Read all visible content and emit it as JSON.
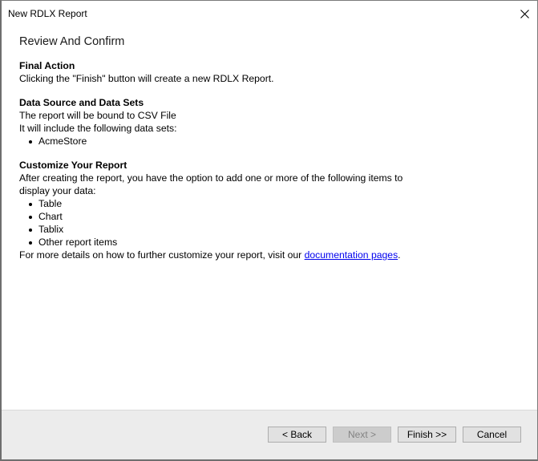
{
  "window": {
    "title": "New RDLX Report",
    "close_icon": "close-icon"
  },
  "main": {
    "heading": "Review And Confirm",
    "sections": [
      {
        "title": "Final Action",
        "lines": [
          "Clicking the \"Finish\" button will create a new RDLX Report."
        ]
      },
      {
        "title": "Data Source and Data Sets",
        "lines": [
          "The report will be bound to CSV File",
          "It will include the following data sets:"
        ],
        "bullets": [
          "AcmeStore"
        ]
      },
      {
        "title": "Customize Your Report",
        "lines": [
          "After creating the report, you have the option to add one or more of the following items to display your data:"
        ],
        "bullets": [
          "Table",
          "Chart",
          "Tablix",
          "Other report items"
        ],
        "footer_prefix": "For more details on how to further customize your report, visit our ",
        "footer_link": "documentation pages",
        "footer_suffix": "."
      }
    ]
  },
  "footer": {
    "back_label": "< Back",
    "next_label": "Next >",
    "finish_label": "Finish >>",
    "cancel_label": "Cancel",
    "next_disabled": true
  }
}
